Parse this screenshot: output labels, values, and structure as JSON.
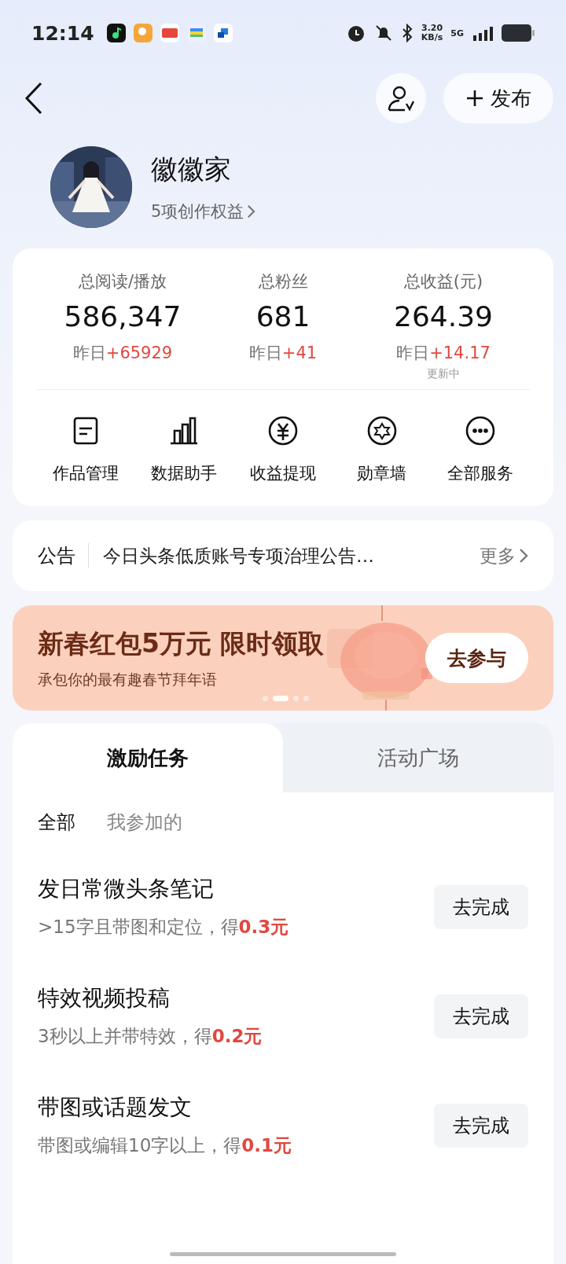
{
  "status_bar": {
    "time": "12:14",
    "speed": "3.20",
    "speed_unit": "KB/s",
    "network": "5G"
  },
  "header": {
    "publish_label": "发布"
  },
  "profile": {
    "name": "徽徽家",
    "benefits": "5项创作权益"
  },
  "stats": [
    {
      "label": "总阅读/播放",
      "value": "586,347",
      "prefix": "昨日",
      "delta": "+65929"
    },
    {
      "label": "总粉丝",
      "value": "681",
      "prefix": "昨日",
      "delta": "+41"
    },
    {
      "label": "总收益(元)",
      "value": "264.39",
      "prefix": "昨日",
      "delta": "+14.17",
      "note": "更新中"
    }
  ],
  "services": [
    {
      "kind": "doc",
      "label": "作品管理"
    },
    {
      "kind": "chart",
      "label": "数据助手"
    },
    {
      "kind": "yuan",
      "label": "收益提现"
    },
    {
      "kind": "badge",
      "label": "勋章墙"
    },
    {
      "kind": "more",
      "label": "全部服务"
    }
  ],
  "notice": {
    "label": "公告",
    "text": "今日头条低质账号专项治理公告…",
    "more": "更多"
  },
  "banner": {
    "title": "新春红包5万元 限时领取",
    "subtitle": "承包你的最有趣春节拜年语",
    "button": "去参与",
    "dots": [
      {
        "selected": false
      },
      {
        "selected": true
      },
      {
        "selected": false
      },
      {
        "selected": false
      }
    ]
  },
  "tabs": [
    {
      "label": "激励任务",
      "selected": true
    },
    {
      "label": "活动广场",
      "selected": false
    }
  ],
  "filters": [
    {
      "label": "全部",
      "selected": true
    },
    {
      "label": "我参加的",
      "selected": false
    }
  ],
  "tasks": [
    {
      "title": "发日常微头条笔记",
      "desc": ">15字且带图和定位，得",
      "reward": "0.3元",
      "button": "去完成"
    },
    {
      "title": "特效视频投稿",
      "desc": "3秒以上并带特效，得",
      "reward": "0.2元",
      "button": "去完成"
    },
    {
      "title": "带图或话题发文",
      "desc": "带图或编辑10字以上，得",
      "reward": "0.1元",
      "button": "去完成"
    }
  ]
}
